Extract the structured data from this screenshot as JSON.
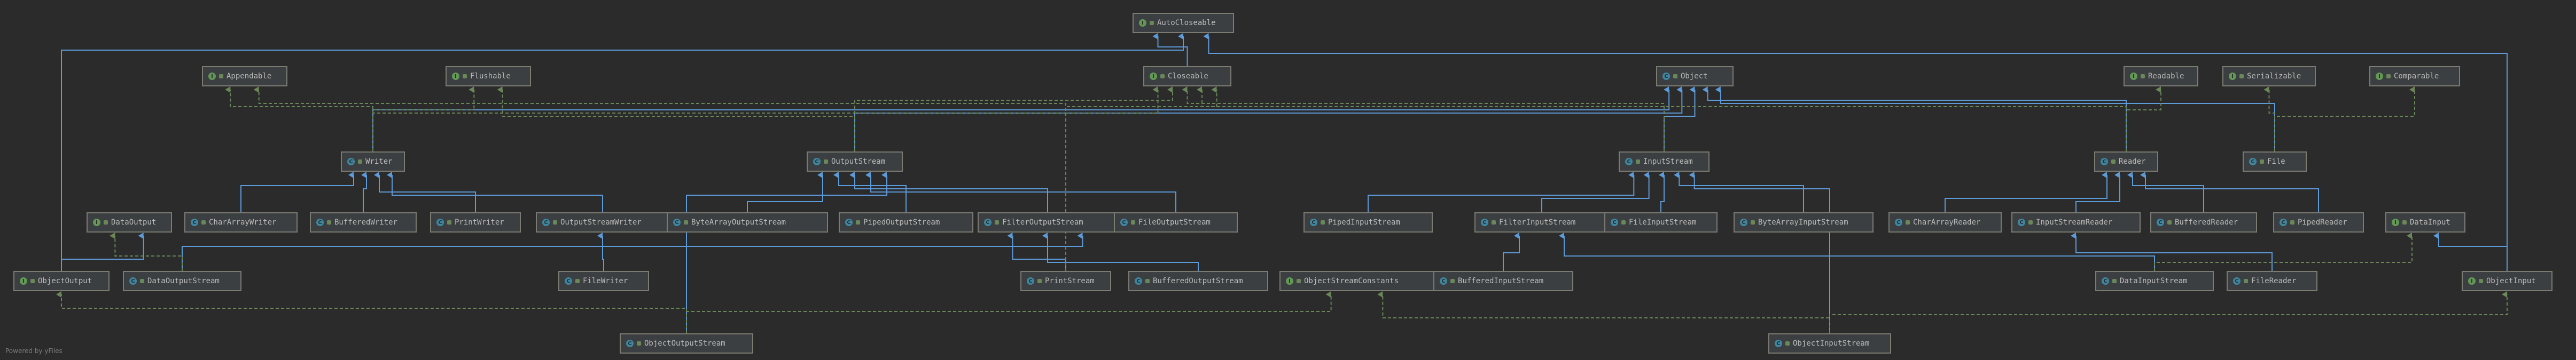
{
  "diagram": {
    "nodes": [
      {
        "id": "AutoCloseable",
        "label": "AutoCloseable",
        "kind": "interface"
      },
      {
        "id": "Appendable",
        "label": "Appendable",
        "kind": "interface"
      },
      {
        "id": "Flushable",
        "label": "Flushable",
        "kind": "interface"
      },
      {
        "id": "Closeable",
        "label": "Closeable",
        "kind": "interface"
      },
      {
        "id": "Object",
        "label": "Object",
        "kind": "class"
      },
      {
        "id": "Readable",
        "label": "Readable",
        "kind": "interface"
      },
      {
        "id": "Serializable",
        "label": "Serializable",
        "kind": "interface"
      },
      {
        "id": "Comparable",
        "label": "Comparable",
        "kind": "interface"
      },
      {
        "id": "Writer",
        "label": "Writer",
        "kind": "class"
      },
      {
        "id": "OutputStream",
        "label": "OutputStream",
        "kind": "class"
      },
      {
        "id": "InputStream",
        "label": "InputStream",
        "kind": "class"
      },
      {
        "id": "Reader",
        "label": "Reader",
        "kind": "class"
      },
      {
        "id": "File",
        "label": "File",
        "kind": "class"
      },
      {
        "id": "DataOutput",
        "label": "DataOutput",
        "kind": "interface"
      },
      {
        "id": "CharArrayWriter",
        "label": "CharArrayWriter",
        "kind": "class"
      },
      {
        "id": "BufferedWriter",
        "label": "BufferedWriter",
        "kind": "class"
      },
      {
        "id": "PrintWriter",
        "label": "PrintWriter",
        "kind": "class"
      },
      {
        "id": "OutputStreamWriter",
        "label": "OutputStreamWriter",
        "kind": "class"
      },
      {
        "id": "ByteArrayOutputStream",
        "label": "ByteArrayOutputStream",
        "kind": "class"
      },
      {
        "id": "PipedOutputStream",
        "label": "PipedOutputStream",
        "kind": "class"
      },
      {
        "id": "FilterOutputStream",
        "label": "FilterOutputStream",
        "kind": "class"
      },
      {
        "id": "FileOutputStream",
        "label": "FileOutputStream",
        "kind": "class"
      },
      {
        "id": "PipedInputStream",
        "label": "PipedInputStream",
        "kind": "class"
      },
      {
        "id": "FilterInputStream",
        "label": "FilterInputStream",
        "kind": "class"
      },
      {
        "id": "FileInputStream",
        "label": "FileInputStream",
        "kind": "class"
      },
      {
        "id": "ByteArrayInputStream",
        "label": "ByteArrayInputStream",
        "kind": "class"
      },
      {
        "id": "CharArrayReader",
        "label": "CharArrayReader",
        "kind": "class"
      },
      {
        "id": "InputStreamReader",
        "label": "InputStreamReader",
        "kind": "class"
      },
      {
        "id": "BufferedReader",
        "label": "BufferedReader",
        "kind": "class"
      },
      {
        "id": "PipedReader",
        "label": "PipedReader",
        "kind": "class"
      },
      {
        "id": "DataInput",
        "label": "DataInput",
        "kind": "interface"
      },
      {
        "id": "ObjectOutput",
        "label": "ObjectOutput",
        "kind": "interface"
      },
      {
        "id": "DataOutputStream",
        "label": "DataOutputStream",
        "kind": "class"
      },
      {
        "id": "FileWriter",
        "label": "FileWriter",
        "kind": "class"
      },
      {
        "id": "PrintStream",
        "label": "PrintStream",
        "kind": "class"
      },
      {
        "id": "BufferedOutputStream",
        "label": "BufferedOutputStream",
        "kind": "class"
      },
      {
        "id": "ObjectStreamConstants",
        "label": "ObjectStreamConstants",
        "kind": "interface"
      },
      {
        "id": "BufferedInputStream",
        "label": "BufferedInputStream",
        "kind": "class"
      },
      {
        "id": "DataInputStream",
        "label": "DataInputStream",
        "kind": "class"
      },
      {
        "id": "FileReader",
        "label": "FileReader",
        "kind": "class"
      },
      {
        "id": "ObjectInput",
        "label": "ObjectInput",
        "kind": "interface"
      },
      {
        "id": "ObjectOutputStream",
        "label": "ObjectOutputStream",
        "kind": "class"
      },
      {
        "id": "ObjectInputStream",
        "label": "ObjectInputStream",
        "kind": "class"
      }
    ],
    "edges": [
      {
        "from": "Closeable",
        "to": "AutoCloseable",
        "type": "extends"
      },
      {
        "from": "ObjectOutput",
        "to": "AutoCloseable",
        "type": "extends"
      },
      {
        "from": "ObjectInput",
        "to": "AutoCloseable",
        "type": "extends"
      },
      {
        "from": "Writer",
        "to": "Object",
        "type": "extends"
      },
      {
        "from": "OutputStream",
        "to": "Object",
        "type": "extends"
      },
      {
        "from": "InputStream",
        "to": "Object",
        "type": "extends"
      },
      {
        "from": "Reader",
        "to": "Object",
        "type": "extends"
      },
      {
        "from": "File",
        "to": "Object",
        "type": "extends"
      },
      {
        "from": "Writer",
        "to": "Appendable",
        "type": "implements"
      },
      {
        "from": "Writer",
        "to": "Flushable",
        "type": "implements"
      },
      {
        "from": "Writer",
        "to": "Closeable",
        "type": "implements"
      },
      {
        "from": "OutputStream",
        "to": "Flushable",
        "type": "implements"
      },
      {
        "from": "OutputStream",
        "to": "Closeable",
        "type": "implements"
      },
      {
        "from": "InputStream",
        "to": "Closeable",
        "type": "implements"
      },
      {
        "from": "Reader",
        "to": "Closeable",
        "type": "implements"
      },
      {
        "from": "Reader",
        "to": "Readable",
        "type": "implements"
      },
      {
        "from": "File",
        "to": "Serializable",
        "type": "implements"
      },
      {
        "from": "File",
        "to": "Comparable",
        "type": "implements"
      },
      {
        "from": "CharArrayWriter",
        "to": "Writer",
        "type": "extends"
      },
      {
        "from": "BufferedWriter",
        "to": "Writer",
        "type": "extends"
      },
      {
        "from": "PrintWriter",
        "to": "Writer",
        "type": "extends"
      },
      {
        "from": "OutputStreamWriter",
        "to": "Writer",
        "type": "extends"
      },
      {
        "from": "FileWriter",
        "to": "OutputStreamWriter",
        "type": "extends"
      },
      {
        "from": "ByteArrayOutputStream",
        "to": "OutputStream",
        "type": "extends"
      },
      {
        "from": "PipedOutputStream",
        "to": "OutputStream",
        "type": "extends"
      },
      {
        "from": "FilterOutputStream",
        "to": "OutputStream",
        "type": "extends"
      },
      {
        "from": "FileOutputStream",
        "to": "OutputStream",
        "type": "extends"
      },
      {
        "from": "ObjectOutputStream",
        "to": "OutputStream",
        "type": "extends"
      },
      {
        "from": "PrintStream",
        "to": "FilterOutputStream",
        "type": "extends"
      },
      {
        "from": "BufferedOutputStream",
        "to": "FilterOutputStream",
        "type": "extends"
      },
      {
        "from": "DataOutputStream",
        "to": "FilterOutputStream",
        "type": "extends"
      },
      {
        "from": "PrintStream",
        "to": "Appendable",
        "type": "implements"
      },
      {
        "from": "PrintStream",
        "to": "Closeable",
        "type": "implements"
      },
      {
        "from": "PipedInputStream",
        "to": "InputStream",
        "type": "extends"
      },
      {
        "from": "FilterInputStream",
        "to": "InputStream",
        "type": "extends"
      },
      {
        "from": "FileInputStream",
        "to": "InputStream",
        "type": "extends"
      },
      {
        "from": "ByteArrayInputStream",
        "to": "InputStream",
        "type": "extends"
      },
      {
        "from": "ObjectInputStream",
        "to": "InputStream",
        "type": "extends"
      },
      {
        "from": "BufferedInputStream",
        "to": "FilterInputStream",
        "type": "extends"
      },
      {
        "from": "DataInputStream",
        "to": "FilterInputStream",
        "type": "extends"
      },
      {
        "from": "CharArrayReader",
        "to": "Reader",
        "type": "extends"
      },
      {
        "from": "InputStreamReader",
        "to": "Reader",
        "type": "extends"
      },
      {
        "from": "BufferedReader",
        "to": "Reader",
        "type": "extends"
      },
      {
        "from": "PipedReader",
        "to": "Reader",
        "type": "extends"
      },
      {
        "from": "FileReader",
        "to": "InputStreamReader",
        "type": "extends"
      },
      {
        "from": "DataOutputStream",
        "to": "DataOutput",
        "type": "implements"
      },
      {
        "from": "ObjectOutput",
        "to": "DataOutput",
        "type": "extends"
      },
      {
        "from": "DataInputStream",
        "to": "DataInput",
        "type": "implements"
      },
      {
        "from": "ObjectInput",
        "to": "DataInput",
        "type": "extends"
      },
      {
        "from": "ObjectOutputStream",
        "to": "ObjectOutput",
        "type": "implements"
      },
      {
        "from": "ObjectOutputStream",
        "to": "ObjectStreamConstants",
        "type": "implements"
      },
      {
        "from": "ObjectInputStream",
        "to": "ObjectInput",
        "type": "implements"
      },
      {
        "from": "ObjectInputStream",
        "to": "ObjectStreamConstants",
        "type": "implements"
      }
    ]
  },
  "colors": {
    "background": "#2b2b2b",
    "node_fill": "#3c3f41",
    "node_border": "#7b7b72",
    "label": "#bbbbbb",
    "class_badge": "#3e86a0",
    "interface_badge": "#629755",
    "extends_edge": "#5d9ad8",
    "implements_edge": "#6a8759"
  },
  "footer": "Powered by yFiles"
}
